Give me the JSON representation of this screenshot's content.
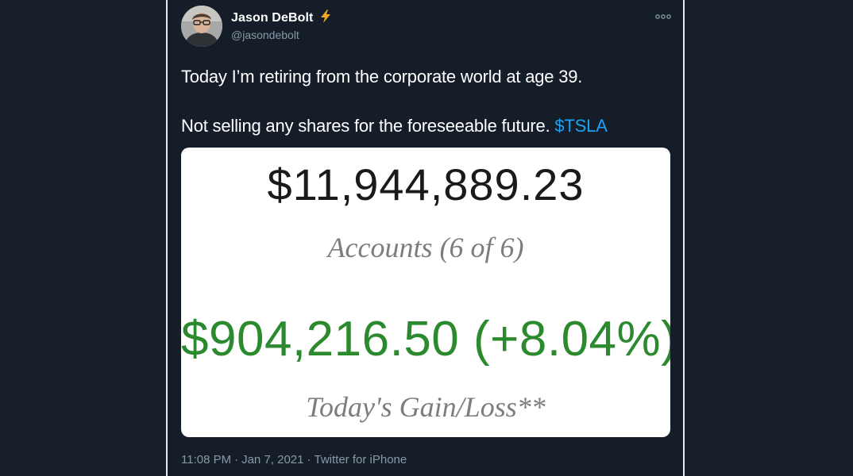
{
  "author": {
    "name": "Jason DeBolt",
    "handle": "@jasondebolt",
    "badge_icon": "lightning-bolt-icon",
    "badge_color": "#f5a623"
  },
  "tweet": {
    "line1": "Today I’m retiring from the corporate world at age 39.",
    "line2_prefix": "Not selling any shares for the foreseeable future. ",
    "cashtag": "$TSLA",
    "more_icon": "more-options-icon"
  },
  "card": {
    "total_value": "$11,944,889.23",
    "accounts_label": "Accounts (6 of 6)",
    "gain_value": "$904,216.50 (+8.04%)",
    "gain_label": "Today's Gain/Loss**",
    "gain_color": "#2b8a2e"
  },
  "meta": {
    "time": "11:08 PM",
    "date": "Jan 7, 2021",
    "source": "Twitter for iPhone",
    "separator": "·"
  },
  "colors": {
    "background": "#17202a",
    "link": "#1da1f2",
    "muted": "#8899a6"
  }
}
